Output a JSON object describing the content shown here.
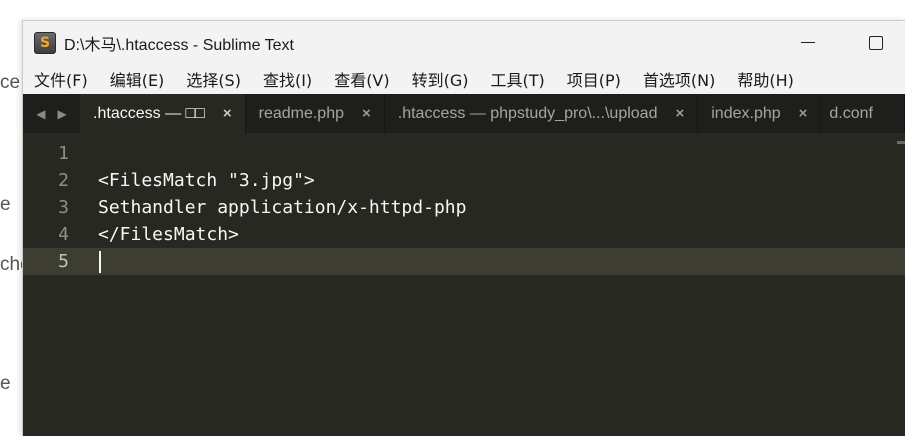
{
  "background_fragments": [
    "ce",
    "e",
    "che",
    "e"
  ],
  "window": {
    "title": "D:\\木马\\.htaccess - Sublime Text",
    "app_icon_letter": "S"
  },
  "menu": [
    "文件(F)",
    "编辑(E)",
    "选择(S)",
    "查找(I)",
    "查看(V)",
    "转到(G)",
    "工具(T)",
    "项目(P)",
    "首选项(N)",
    "帮助(H)"
  ],
  "tabs": [
    {
      "label": ".htaccess — □□",
      "active": true
    },
    {
      "label": "readme.php",
      "active": false
    },
    {
      "label": ".htaccess — phpstudy_pro\\...\\upload",
      "active": false
    },
    {
      "label": "index.php",
      "active": false
    },
    {
      "label": "d.conf",
      "active": false
    }
  ],
  "tab_close_glyph": "×",
  "editor": {
    "line_numbers": [
      "1",
      "2",
      "3",
      "4",
      "5"
    ],
    "lines": [
      "",
      "<FilesMatch \"3.jpg\">",
      "Sethandler application/x-httpd-php",
      "</FilesMatch>",
      ""
    ],
    "current_line": 5
  },
  "colors": {
    "editor_bg": "#272822",
    "tabbar_bg": "#1e1f1c",
    "current_line": "#3e3d32",
    "text": "#f8f8f2"
  }
}
